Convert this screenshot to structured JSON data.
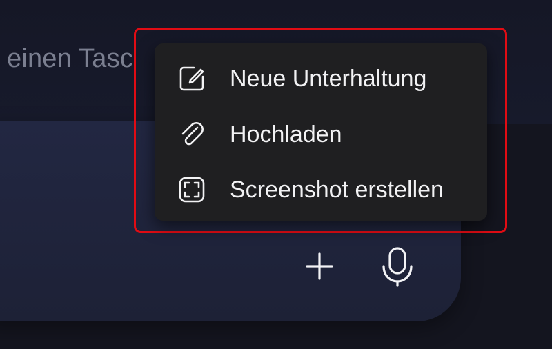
{
  "composer": {
    "placeholder_fragment": "einen Tasc",
    "plus_icon": "plus-icon",
    "mic_icon": "microphone-icon"
  },
  "menu": {
    "items": [
      {
        "label": "Neue Unterhaltung",
        "icon": "compose-icon"
      },
      {
        "label": "Hochladen",
        "icon": "paperclip-icon"
      },
      {
        "label": "Screenshot erstellen",
        "icon": "screenshot-icon"
      }
    ]
  },
  "colors": {
    "background": "#14151f",
    "card": "#222742",
    "menu": "#1f1f21",
    "highlight": "#e10c14",
    "text": "#f2f2f4",
    "hint": "#7b7f90"
  }
}
